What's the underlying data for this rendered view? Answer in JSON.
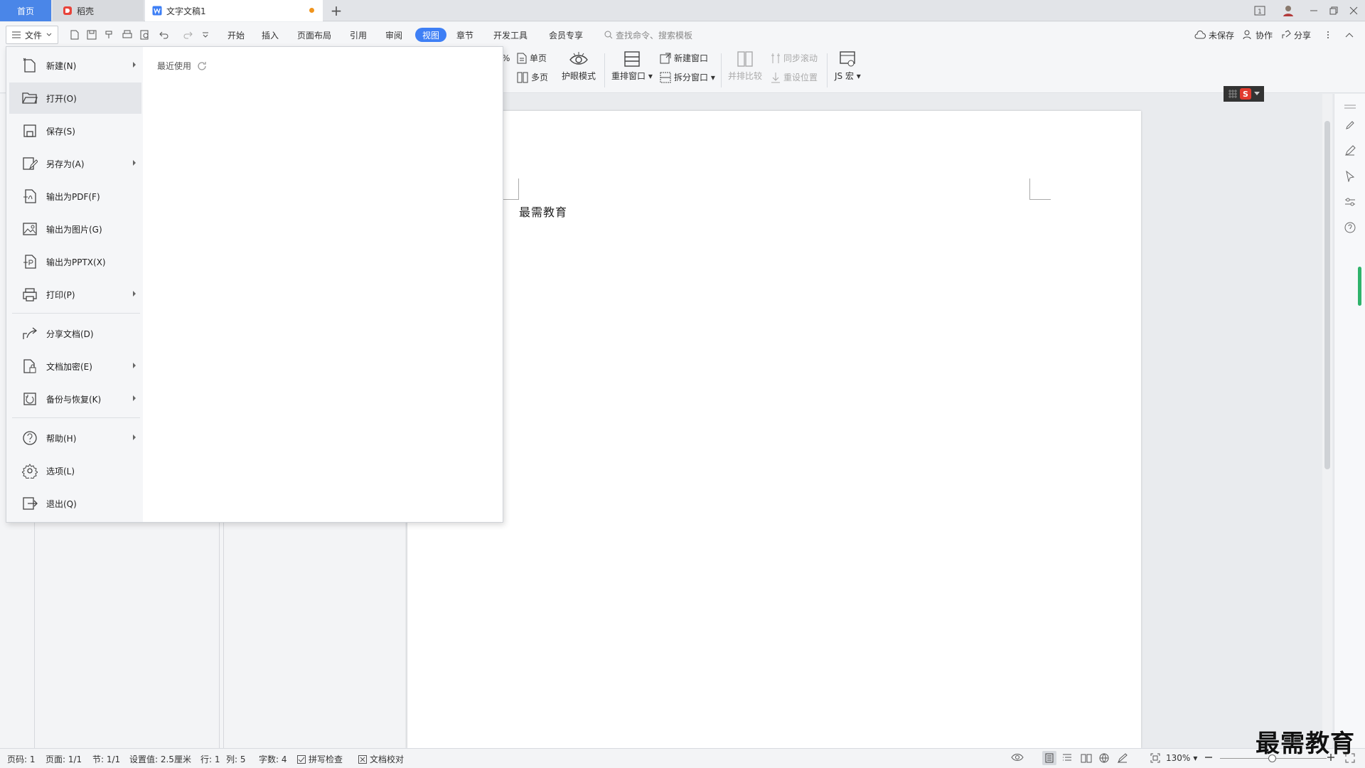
{
  "tabs": {
    "home": "首页",
    "daoke": "稻壳",
    "doc": "文字文稿1",
    "add": "+"
  },
  "menubar": {
    "file": "文件",
    "tabs": [
      "开始",
      "插入",
      "页面布局",
      "引用",
      "审阅",
      "视图",
      "章节",
      "开发工具",
      "会员专享"
    ],
    "active_tab": "视图",
    "search_placeholder": "查找命令、搜索模板",
    "unsaved": "未保存",
    "collab": "协作",
    "share": "分享"
  },
  "ribbon": {
    "partial_percent": "%",
    "single_page": "单页",
    "multi_page": "多页",
    "eye_mode": "护眼模式",
    "rearrange": "重排窗口",
    "new_window": "新建窗口",
    "split_window": "拆分窗口",
    "compare": "并排比较",
    "sync_scroll": "同步滚动",
    "reset_pos": "重设位置",
    "js_macro": "JS 宏"
  },
  "filemenu": {
    "items": [
      {
        "label": "新建(N)",
        "icon": "new-doc-icon"
      },
      {
        "label": "打开(O)",
        "icon": "folder-open-icon"
      },
      {
        "label": "保存(S)",
        "icon": "save-icon"
      },
      {
        "label": "另存为(A)",
        "icon": "save-as-icon"
      },
      {
        "label": "输出为PDF(F)",
        "icon": "export-pdf-icon"
      },
      {
        "label": "输出为图片(G)",
        "icon": "export-image-icon"
      },
      {
        "label": "输出为PPTX(X)",
        "icon": "export-pptx-icon"
      },
      {
        "label": "打印(P)",
        "icon": "print-icon"
      },
      {
        "label": "分享文档(D)",
        "icon": "share-icon"
      },
      {
        "label": "文档加密(E)",
        "icon": "encrypt-icon"
      },
      {
        "label": "备份与恢复(K)",
        "icon": "backup-icon"
      },
      {
        "label": "帮助(H)",
        "icon": "help-icon"
      },
      {
        "label": "选项(L)",
        "icon": "settings-icon"
      },
      {
        "label": "退出(Q)",
        "icon": "exit-icon"
      }
    ],
    "recent": "最近使用"
  },
  "document": {
    "text": "最需教育"
  },
  "statusbar": {
    "page_num": "页码: 1",
    "pages": "页面: 1/1",
    "section": "节: 1/1",
    "setting": "设置值: 2.5厘米",
    "row": "行: 1",
    "col": "列: 5",
    "words": "字数: 4",
    "spell": "拼写检查",
    "proof": "文档校对",
    "zoom": "130%"
  },
  "watermark": "最需教育"
}
